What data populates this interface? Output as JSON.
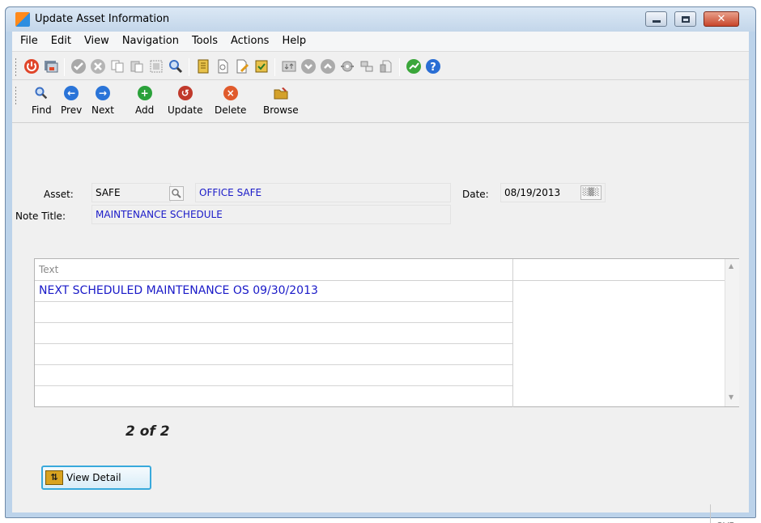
{
  "window": {
    "title": "Update Asset Information",
    "close_glyph": "✕"
  },
  "menu": [
    "File",
    "Edit",
    "View",
    "Navigation",
    "Tools",
    "Actions",
    "Help"
  ],
  "toolbar2": [
    {
      "label": "Find",
      "icon": "magnifier-icon",
      "color": "#3a6fc4",
      "glyph": "●"
    },
    {
      "label": "Prev",
      "icon": "prev-icon",
      "color": "#2a74d8",
      "glyph": "←"
    },
    {
      "label": "Next",
      "icon": "next-icon",
      "color": "#2a74d8",
      "glyph": "→"
    },
    {
      "label": "Add",
      "icon": "add-icon",
      "color": "#2aa13a",
      "glyph": "+"
    },
    {
      "label": "Update",
      "icon": "update-icon",
      "color": "#c0392b",
      "glyph": "↺"
    },
    {
      "label": "Delete",
      "icon": "delete-icon",
      "color": "#e05a2b",
      "glyph": "×"
    },
    {
      "label": "Browse",
      "icon": "browse-folder-icon",
      "color": "#d4a12a",
      "glyph": ""
    }
  ],
  "form": {
    "asset_label": "Asset:",
    "asset_code": "SAFE",
    "asset_name": "OFFICE SAFE",
    "date_label": "Date:",
    "date_value": "08/19/2013",
    "note_title_label": "Note Title:",
    "note_title_value": "MAINTENANCE SCHEDULE"
  },
  "grid": {
    "header": "Text",
    "rows": [
      "NEXT SCHEDULED MAINTENANCE OS 09/30/2013",
      "",
      "",
      "",
      "",
      ""
    ]
  },
  "counter": "2 of 2",
  "view_detail_label": "View Detail",
  "status": {
    "mode": "OVR"
  }
}
